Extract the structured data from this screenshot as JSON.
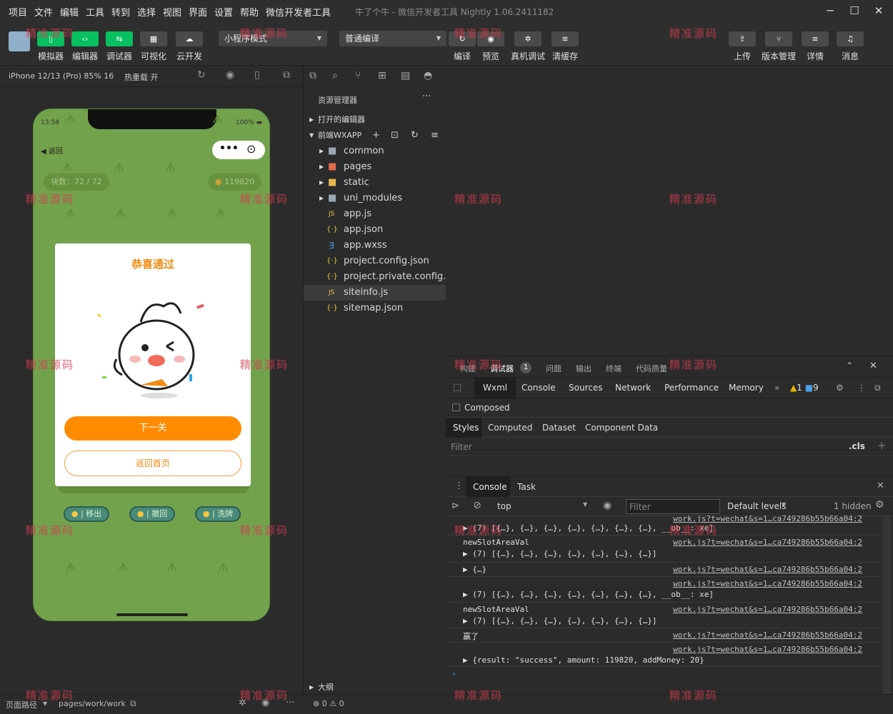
{
  "menubar": {
    "items": [
      "项目",
      "文件",
      "编辑",
      "工具",
      "转到",
      "选择",
      "视图",
      "界面",
      "设置",
      "帮助",
      "微信开发者工具"
    ],
    "window_title": "牛了个牛 - 微信开发者工具 Nightly 1.06.2411182"
  },
  "toolbar": {
    "left_buttons": [
      "模拟器",
      "编辑器",
      "调试器",
      "可视化",
      "云开发"
    ],
    "mode_select": "小程序模式",
    "compile_select": "普通编译",
    "mid_buttons": [
      "编译",
      "预览",
      "真机调试",
      "清缓存"
    ],
    "right_buttons": [
      "上传",
      "版本管理",
      "详情",
      "消息"
    ]
  },
  "simulator": {
    "device": "iPhone 12/13 (Pro) 85% 16",
    "hot_reload": "热重载 开",
    "status_time": "13:58",
    "status_battery": "100%",
    "back_label": "返回",
    "tiles_pill": "块数：72 / 72",
    "coins_pill": "119820",
    "modal_title": "恭喜通过",
    "next_button": "下一关",
    "home_button": "返回首页",
    "tools": [
      "移出",
      "撤回",
      "洗牌"
    ]
  },
  "explorer": {
    "title": "资源管理器",
    "open_editors": "打开的编辑器",
    "project": "前端WXAPP",
    "files": [
      {
        "name": "common",
        "type": "folder"
      },
      {
        "name": "pages",
        "type": "folder-pages"
      },
      {
        "name": "static",
        "type": "folder-static"
      },
      {
        "name": "uni_modules",
        "type": "folder"
      },
      {
        "name": "app.js",
        "type": "js"
      },
      {
        "name": "app.json",
        "type": "json"
      },
      {
        "name": "app.wxss",
        "type": "css"
      },
      {
        "name": "project.config.json",
        "type": "json"
      },
      {
        "name": "project.private.config.js...",
        "type": "json"
      },
      {
        "name": "siteinfo.js",
        "type": "js"
      },
      {
        "name": "sitemap.json",
        "type": "json"
      }
    ],
    "outline": "大纲",
    "problems": "0",
    "warnings": "0"
  },
  "debug_tabs": [
    "构建",
    "调试器",
    "问题",
    "输出",
    "终端",
    "代码质量"
  ],
  "debug_badge": "1",
  "devtools_tabs": [
    "Wxml",
    "Console",
    "Sources",
    "Network",
    "Performance",
    "Memory"
  ],
  "devtools_counts": {
    "warn": "1",
    "info": "9"
  },
  "composed_label": "Composed",
  "styles_tabs": [
    "Styles",
    "Computed",
    "Dataset",
    "Component Data"
  ],
  "filter_placeholder": "Filter",
  "cls_label": ".cls",
  "console_tabs": [
    "Console",
    "Task"
  ],
  "console_toolbar": {
    "context": "top",
    "filter": "Filter",
    "levels": "Default levels",
    "hidden": "1 hidden"
  },
  "console_lines": [
    {
      "text": "▶ (7) [{…}, {…}, {…}, {…}, {…}, {…}, {…}, __ob__: xe]",
      "link": "work.js?t=wechat&s=1…ca749286b55b66a04:2"
    },
    {
      "text": "newSlotAreaVal",
      "text2": "▶ (7) [{…}, {…}, {…}, {…}, {…}, {…}, {…}]",
      "link": "work.js?t=wechat&s=1…ca749286b55b66a04:2"
    },
    {
      "text": "▶ {…}",
      "link": "work.js?t=wechat&s=1…ca749286b55b66a04:2"
    },
    {
      "text": "",
      "text2": "▶ (7) [{…}, {…}, {…}, {…}, {…}, {…}, {…}, __ob__: xe]",
      "link": "work.js?t=wechat&s=1…ca749286b55b66a04:2"
    },
    {
      "text": "newSlotAreaVal",
      "text2": "▶ (7) [{…}, {…}, {…}, {…}, {…}, {…}, {…}]",
      "link": "work.js?t=wechat&s=1…ca749286b55b66a04:2"
    },
    {
      "text": "赢了",
      "link": "work.js?t=wechat&s=1…ca749286b55b66a04:2"
    },
    {
      "text": "",
      "text2": "▶ {result: \"success\", amount: 119820, addMoney: 20}",
      "link": "work.js?t=wechat&s=1…ca749286b55b66a04:2"
    }
  ],
  "bottom": {
    "path_label": "页面路径",
    "path": "pages/work/work"
  },
  "watermark": "精准源码",
  "colors": {
    "accent_green": "#07c160",
    "phone_bg": "#73a24d",
    "orange": "#ff8c00"
  }
}
